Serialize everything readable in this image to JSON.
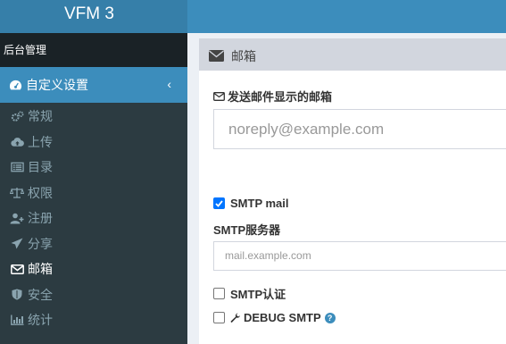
{
  "app": {
    "title": "VFM 3"
  },
  "sidebar": {
    "header": "后台管理",
    "open_menu": {
      "label": "自定义设置",
      "icon": "dashboard-icon"
    },
    "items": [
      {
        "label": "常规",
        "icon": "cogs-icon"
      },
      {
        "label": "上传",
        "icon": "cloud-upload-icon"
      },
      {
        "label": "目录",
        "icon": "list-icon"
      },
      {
        "label": "权限",
        "icon": "balance-icon"
      },
      {
        "label": "注册",
        "icon": "user-plus-icon"
      },
      {
        "label": "分享",
        "icon": "paper-plane-icon"
      },
      {
        "label": "邮箱",
        "icon": "envelope-icon",
        "active": true
      },
      {
        "label": "安全",
        "icon": "shield-icon"
      },
      {
        "label": "统计",
        "icon": "bar-chart-icon"
      }
    ]
  },
  "panel": {
    "title": "邮箱",
    "sender_label": "发送邮件显示的邮箱",
    "sender_placeholder": "noreply@example.com",
    "smtp_mail_label": "SMTP mail",
    "smtp_mail_checked": true,
    "smtp_server_label": "SMTP服务器",
    "smtp_server_placeholder": "mail.example.com",
    "smtp_auth_label": "SMTP认证",
    "smtp_auth_checked": false,
    "debug_label": "DEBUG SMTP",
    "debug_checked": false,
    "help_glyph": "?"
  }
}
